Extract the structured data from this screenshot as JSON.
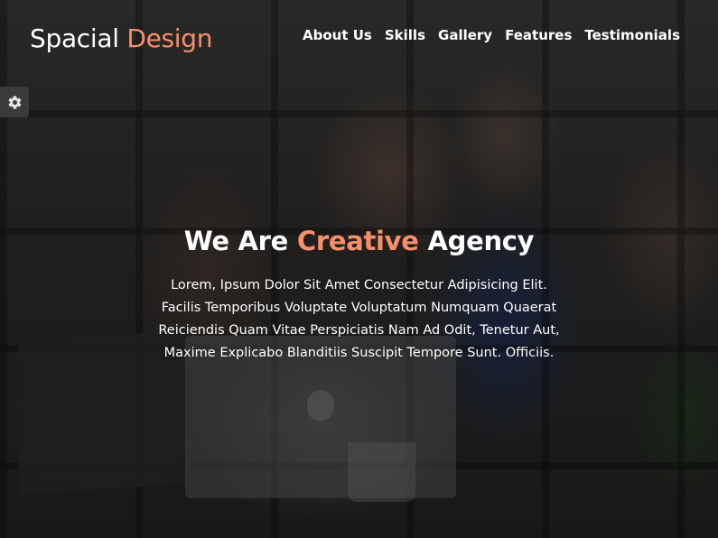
{
  "brand": {
    "part1": "Spacial",
    "part2": "Design"
  },
  "nav": {
    "items": [
      {
        "label": "About Us"
      },
      {
        "label": "Skills"
      },
      {
        "label": "Gallery"
      },
      {
        "label": "Features"
      },
      {
        "label": "Testimonials"
      }
    ]
  },
  "settings": {
    "icon": "gear-icon"
  },
  "hero": {
    "title_prefix": "We Are",
    "title_accent": "Creative",
    "title_suffix": "Agency",
    "paragraph": "Lorem, Ipsum Dolor Sit Amet Consectetur Adipisicing Elit. Facilis Temporibus Voluptate Voluptatum Numquam Quaerat Reiciendis Quam Vitae Perspiciatis Nam Ad Odit, Tenetur Aut, Maxime Explicabo Blanditiis Suscipit Tempore Sunt. Officiis."
  },
  "colors": {
    "accent": "#f88f6a",
    "text": "#ffffff",
    "settings_bg": "#3a3b3d"
  }
}
